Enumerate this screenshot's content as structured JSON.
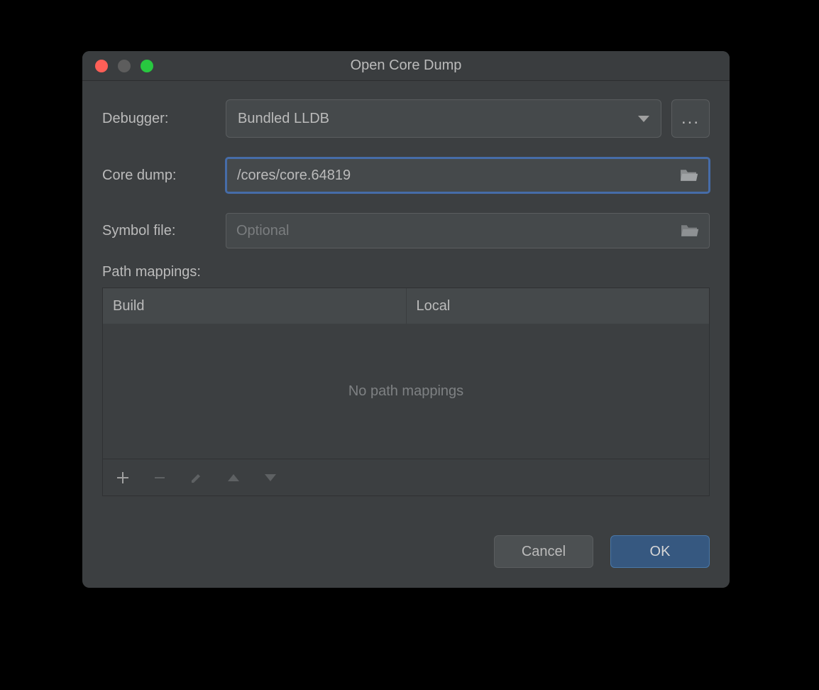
{
  "dialog": {
    "title": "Open Core Dump",
    "debugger": {
      "label": "Debugger:",
      "selected": "Bundled LLDB",
      "more_label": "..."
    },
    "core_dump": {
      "label": "Core dump:",
      "value": "/cores/core.64819"
    },
    "symbol_file": {
      "label": "Symbol file:",
      "value": "",
      "placeholder": "Optional"
    },
    "path_mappings": {
      "label": "Path mappings:",
      "columns": {
        "build": "Build",
        "local": "Local"
      },
      "empty_text": "No path mappings"
    },
    "buttons": {
      "cancel": "Cancel",
      "ok": "OK"
    }
  }
}
